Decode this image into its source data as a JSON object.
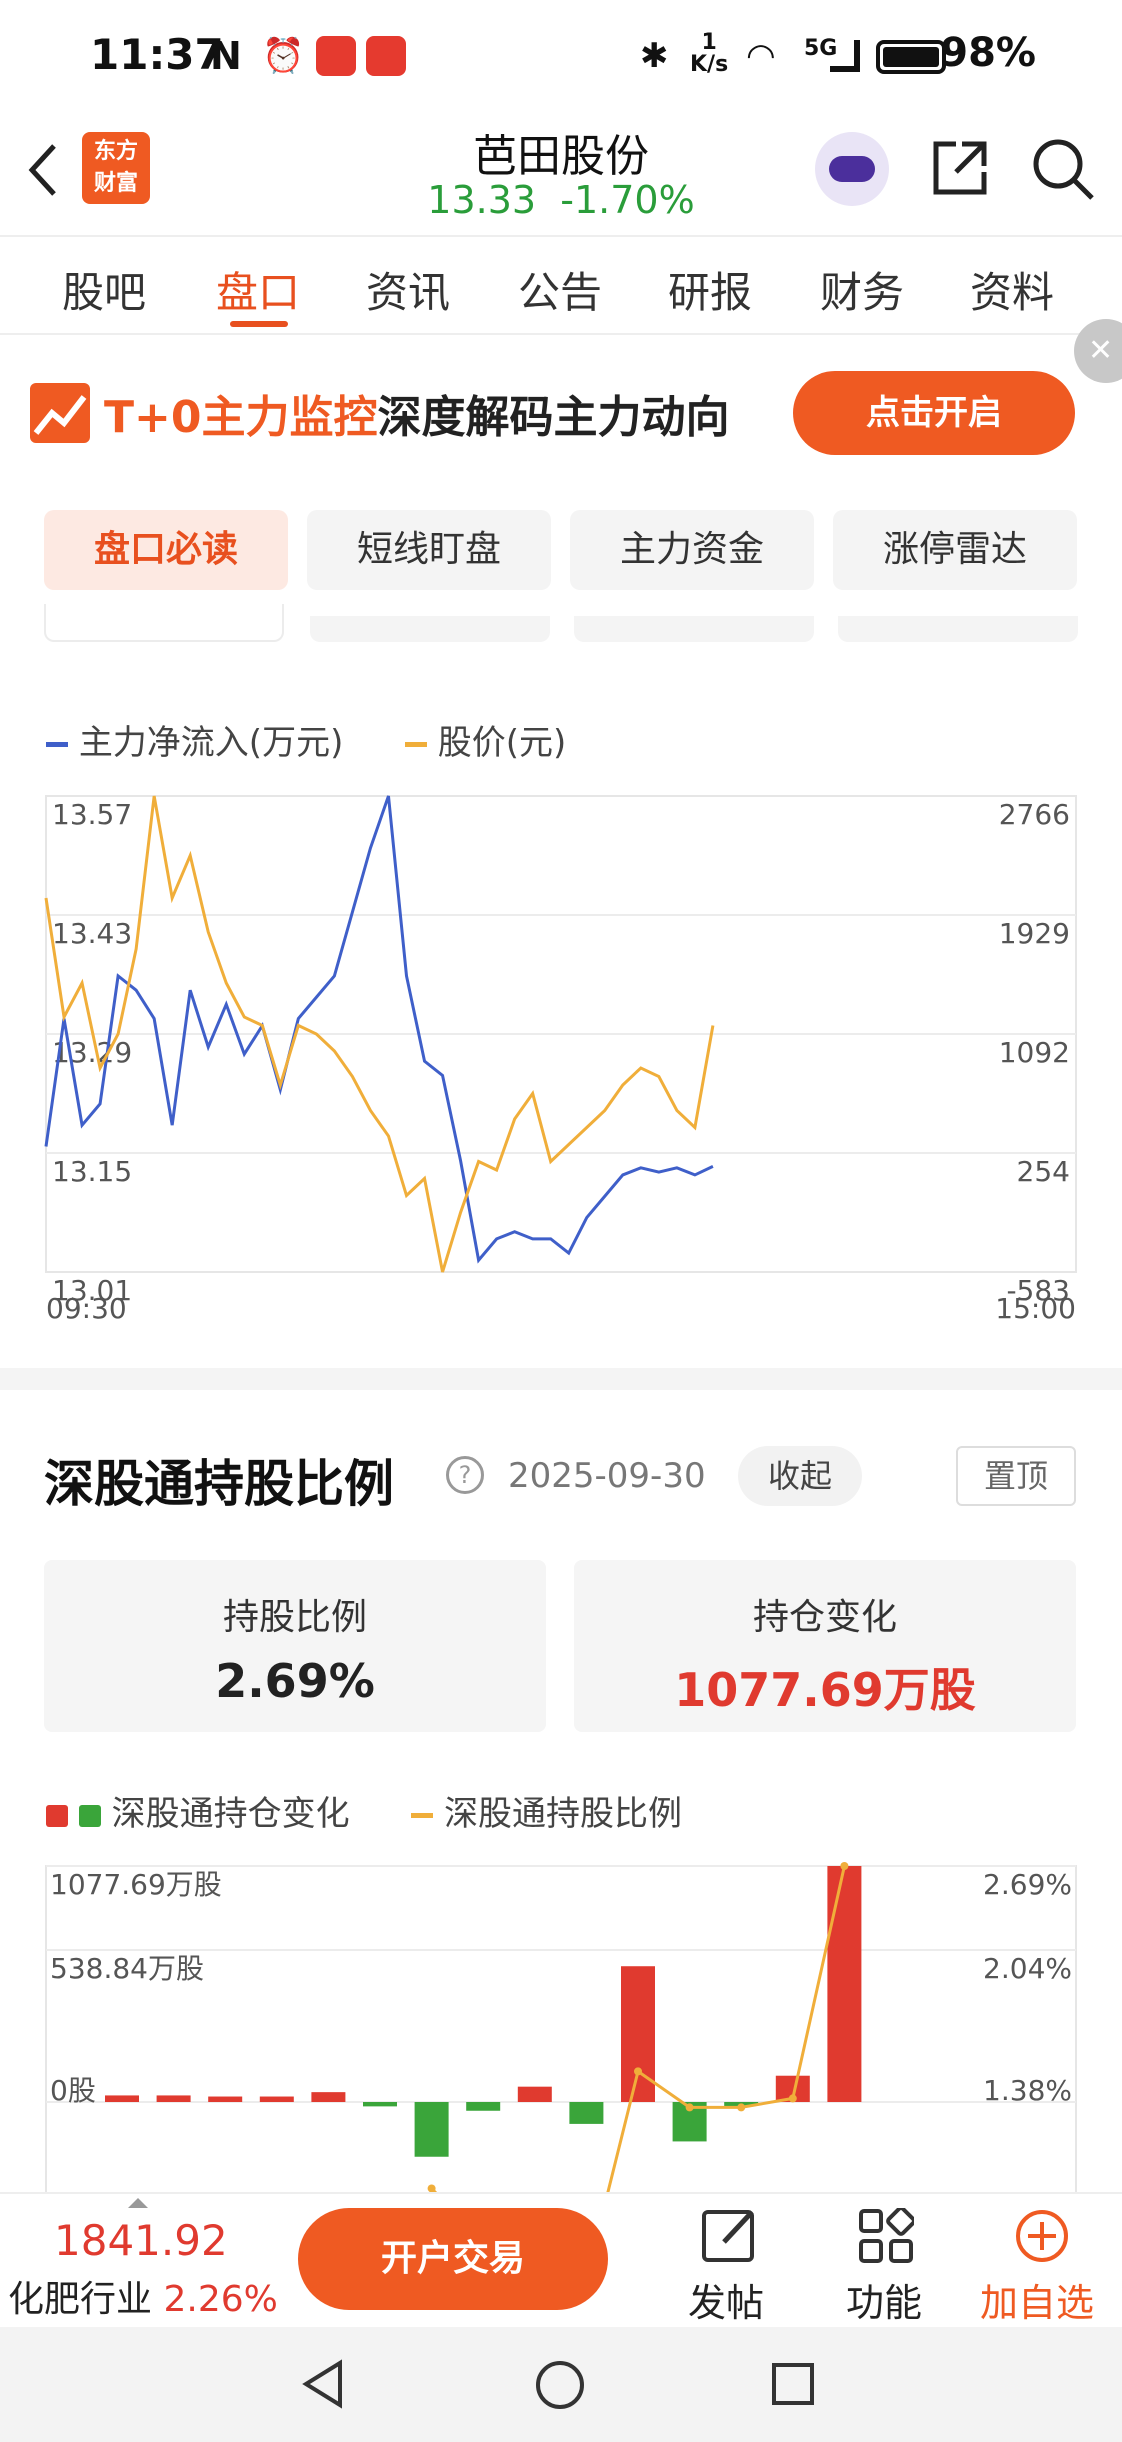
{
  "status": {
    "time": "11:37",
    "battery": "98%",
    "speed_top": "1",
    "speed_unit": "K/s",
    "signal": "5G"
  },
  "header": {
    "logo_line1": "东方",
    "logo_line2": "财富",
    "stock_name": "芭田股份",
    "price": "13.33",
    "change": "-1.70%"
  },
  "tabs": [
    "股吧",
    "盘口",
    "资讯",
    "公告",
    "研报",
    "财务",
    "资料"
  ],
  "active_tab": 1,
  "banner": {
    "highlight": "T+0主力监控",
    "text": "深度解码主力动向",
    "button": "点击开启"
  },
  "subtabs": [
    "盘口必读",
    "短线盯盘",
    "主力资金",
    "涨停雷达"
  ],
  "flow_chart": {
    "legend": [
      "主力净流入(万元)",
      "股价(元)"
    ],
    "left_ticks": [
      "13.57",
      "13.43",
      "13.29",
      "13.15",
      "13.01"
    ],
    "right_ticks": [
      "2766",
      "1929",
      "1092",
      "254",
      "-583"
    ],
    "x_start": "09:30",
    "x_end": "15:00"
  },
  "hk_section": {
    "title": "深股通持股比例",
    "date": "2025-09-30",
    "collapse": "收起",
    "pin": "置顶",
    "card1_label": "持股比例",
    "card1_value": "2.69%",
    "card2_label": "持仓变化",
    "card2_value": "1077.69万股",
    "legend1": "深股通持仓变化",
    "legend2": "深股通持股比例",
    "left_ticks": [
      "1077.69万股",
      "538.84万股",
      "0股"
    ],
    "right_ticks": [
      "2.69%",
      "2.04%",
      "1.38%"
    ]
  },
  "bottom": {
    "index_value": "1841.92",
    "industry": "化肥行业",
    "industry_change": "2.26%",
    "trade_button": "开户交易",
    "post": "发帖",
    "func": "功能",
    "watch": "加自选"
  },
  "colors": {
    "accent": "#e8501f",
    "up": "#e03a2f",
    "down": "#3aa53a",
    "flow_line": "#3f5fc9",
    "price_line": "#f0ae3a"
  },
  "chart_data": [
    {
      "type": "line",
      "title": "",
      "series": [
        {
          "name": "主力净流入(万元)",
          "axis": "right",
          "values": [
            300,
            1200,
            450,
            600,
            1500,
            1400,
            1200,
            450,
            1400,
            1000,
            1300,
            950,
            1150,
            700,
            1200,
            1350,
            1500,
            1950,
            2400,
            2766,
            1500,
            900,
            800,
            200,
            -500,
            -350,
            -300,
            -350,
            -350,
            -450,
            -200,
            -50,
            100,
            150,
            120,
            150,
            100,
            160
          ]
        },
        {
          "name": "股价(元)",
          "axis": "left",
          "values": [
            13.45,
            13.31,
            13.35,
            13.25,
            13.29,
            13.39,
            13.57,
            13.45,
            13.5,
            13.41,
            13.35,
            13.31,
            13.3,
            13.23,
            13.3,
            13.29,
            13.27,
            13.24,
            13.2,
            13.17,
            13.1,
            13.12,
            13.01,
            13.08,
            13.14,
            13.13,
            13.19,
            13.22,
            13.14,
            13.16,
            13.18,
            13.2,
            13.23,
            13.25,
            13.24,
            13.2,
            13.18,
            13.3
          ]
        }
      ],
      "y_left_range": [
        13.01,
        13.57
      ],
      "y_right_range": [
        -583,
        2766
      ]
    },
    {
      "type": "bar",
      "title": "",
      "series": [
        {
          "name": "深股通持仓变化",
          "unit": "万股",
          "values": [
            30,
            30,
            25,
            25,
            45,
            -20,
            -250,
            -40,
            70,
            -100,
            620,
            -180,
            -10,
            120,
            1077.69
          ]
        },
        {
          "name": "深股通持股比例",
          "unit": "%",
          "values": [
            null,
            null,
            null,
            null,
            null,
            null,
            0.9,
            0.6,
            null,
            0.4,
            1.55,
            1.35,
            1.35,
            1.4,
            2.69
          ]
        }
      ],
      "y_left_range": [
        -538.84,
        1077.69
      ],
      "y_right_range": [
        0.72,
        2.69
      ]
    }
  ]
}
